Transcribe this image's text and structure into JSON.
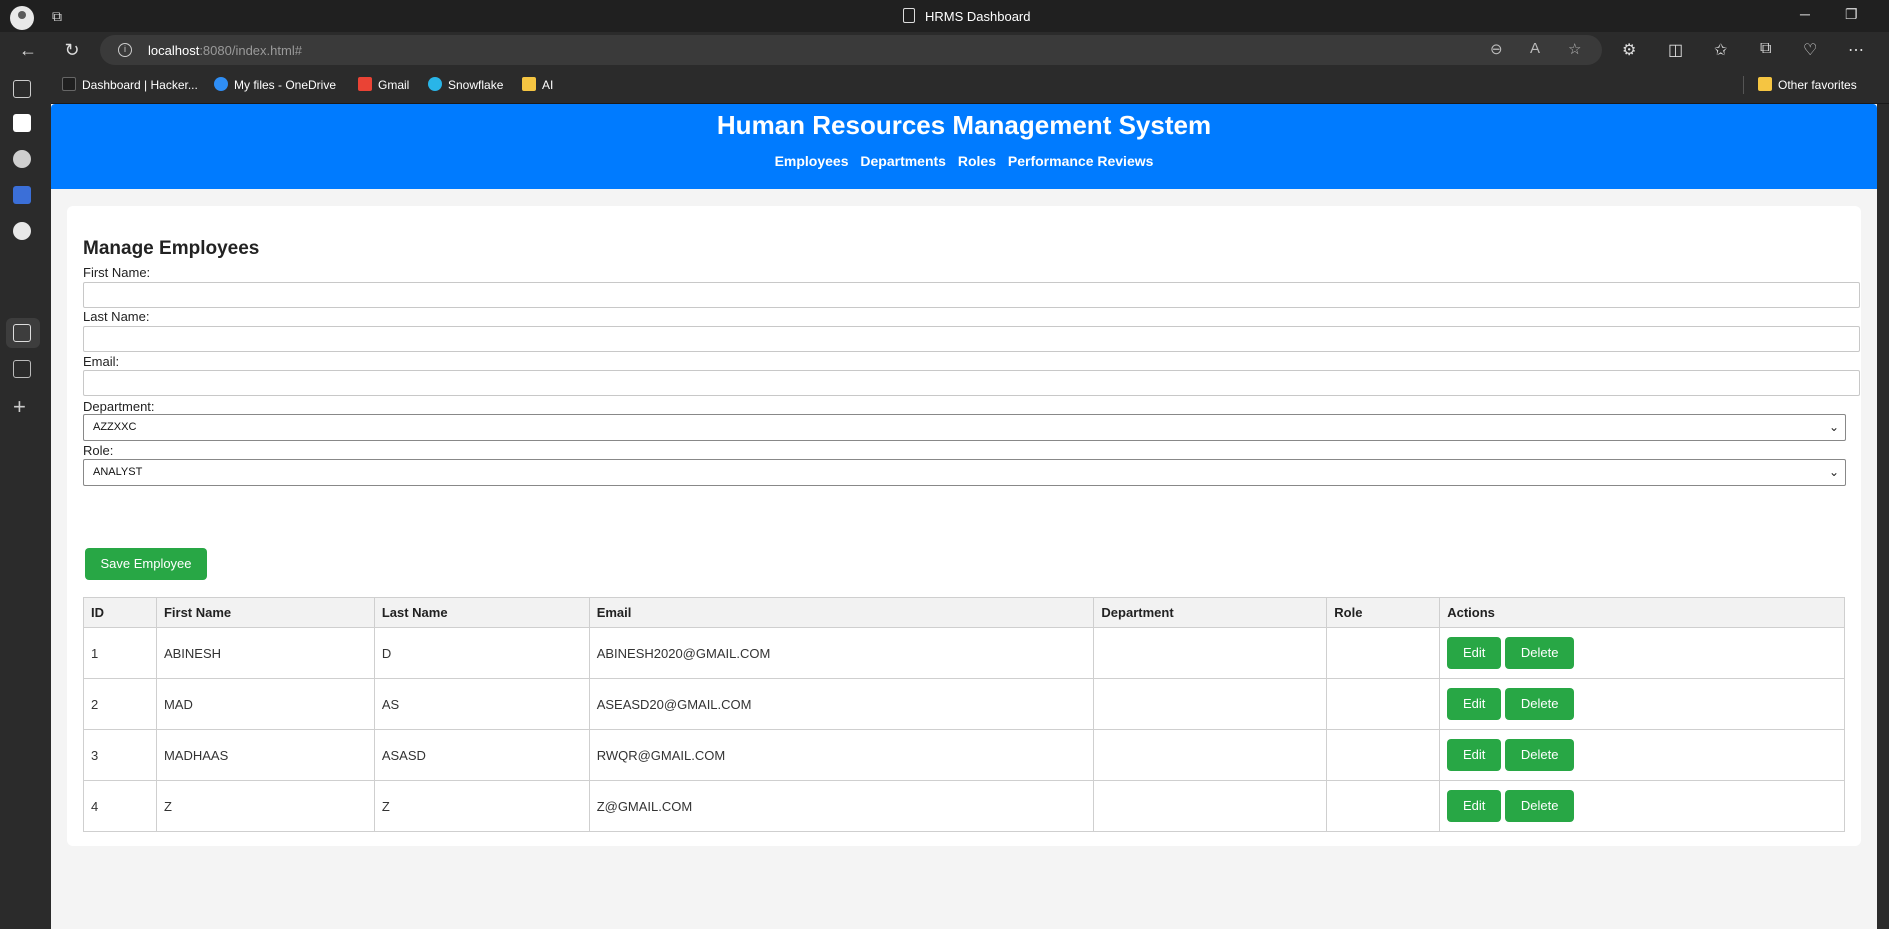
{
  "browser": {
    "window_title": "HRMS Dashboard",
    "url_host": "localhost",
    "url_rest": ":8080/index.html#",
    "favorites": [
      {
        "label": "Dashboard | Hacker...",
        "color": "#1f1f1f"
      },
      {
        "label": "My files - OneDrive",
        "color": "#2f8ef5"
      },
      {
        "label": "Gmail",
        "color": "#ea4335"
      },
      {
        "label": "Snowflake",
        "color": "#29b5e8"
      },
      {
        "label": "AI",
        "color": "#f5c542"
      }
    ],
    "other_favorites": "Other favorites"
  },
  "header": {
    "title": "Human Resources Management System",
    "nav": [
      "Employees",
      "Departments",
      "Roles",
      "Performance Reviews"
    ]
  },
  "form": {
    "heading": "Manage Employees",
    "first_name_label": "First Name:",
    "last_name_label": "Last Name:",
    "email_label": "Email:",
    "department_label": "Department:",
    "department_value": "AZZXXC",
    "role_label": "Role:",
    "role_value": "ANALYST",
    "save_label": "Save Employee"
  },
  "table": {
    "headers": [
      "ID",
      "First Name",
      "Last Name",
      "Email",
      "Department",
      "Role",
      "Actions"
    ],
    "edit_label": "Edit",
    "delete_label": "Delete",
    "rows": [
      {
        "id": "1",
        "first": "ABINESH",
        "last": "D",
        "email": "ABINESH2020@GMAIL.COM",
        "dept": "",
        "role": ""
      },
      {
        "id": "2",
        "first": "MAD",
        "last": "AS",
        "email": "ASEASD20@GMAIL.COM",
        "dept": "",
        "role": ""
      },
      {
        "id": "3",
        "first": "MADHAAS",
        "last": "ASASD",
        "email": "RWQR@GMAIL.COM",
        "dept": "",
        "role": ""
      },
      {
        "id": "4",
        "first": "Z",
        "last": "Z",
        "email": "Z@GMAIL.COM",
        "dept": "",
        "role": ""
      }
    ]
  },
  "colors": {
    "header_blue": "#007bff",
    "button_green": "#28a745"
  }
}
